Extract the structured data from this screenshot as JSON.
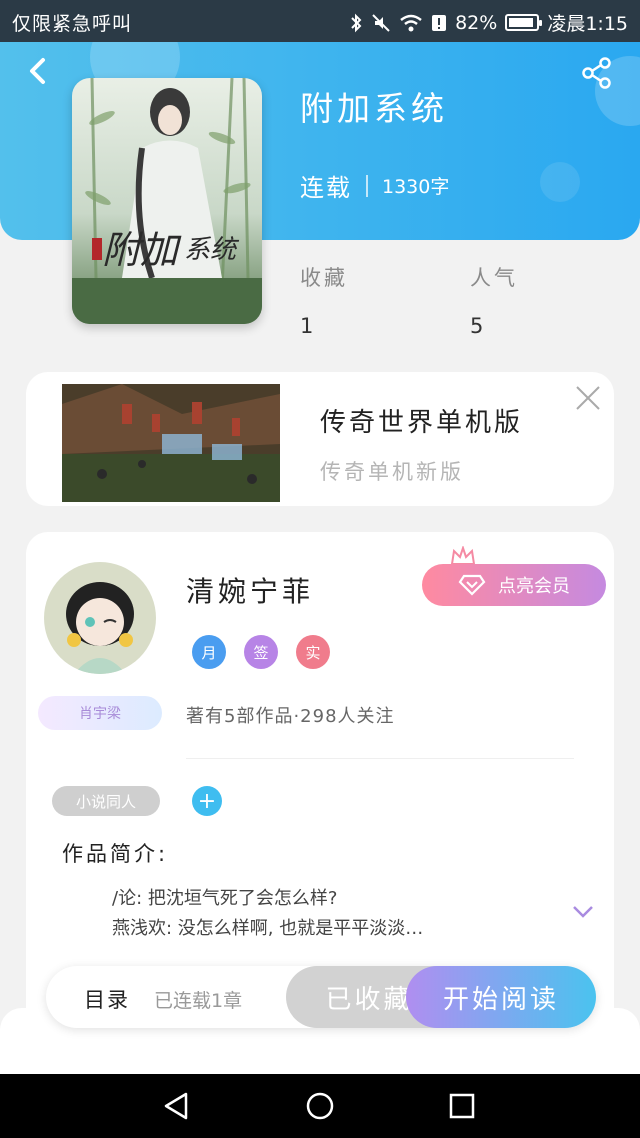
{
  "status_bar": {
    "left_text": "仅限紧急呼叫",
    "battery": "82%",
    "time": "凌晨1:15",
    "icons": [
      "bluetooth-icon",
      "mute-icon",
      "wifi-icon",
      "alert-icon",
      "battery-icon"
    ]
  },
  "header": {
    "book_title": "附加系统",
    "status": "连载",
    "word_count": "1330字",
    "colors": {
      "gradient_start": "#53c0ec",
      "gradient_end": "#2aa8f0"
    }
  },
  "stats": {
    "favorites_label": "收藏",
    "favorites_value": "1",
    "popularity_label": "人气",
    "popularity_value": "5"
  },
  "ad": {
    "title": "传奇世界单机版",
    "subtitle": "传奇单机新版"
  },
  "author": {
    "name": "清婉宁菲",
    "vip_button": "点亮会员",
    "badges": [
      {
        "label": "月",
        "color": "#4a9df0"
      },
      {
        "label": "签",
        "color": "#b784e6"
      },
      {
        "label": "实",
        "color": "#f07c8c"
      }
    ],
    "nickname_tag": "肖宇梁",
    "works_info": "著有5部作品·298人关注"
  },
  "tags": {
    "items": [
      "小说同人"
    ],
    "add_label": "+"
  },
  "intro": {
    "label": "作品简介:",
    "line1": "/论: 把沈垣气死了会怎么样?",
    "line2": "燕浅欢: 没怎么样啊, 也就是平平淡淡…"
  },
  "action_bar": {
    "toc_label": "目录",
    "chapters_label": "已连载1章",
    "collected_label": "已收藏",
    "read_label": "开始阅读"
  }
}
